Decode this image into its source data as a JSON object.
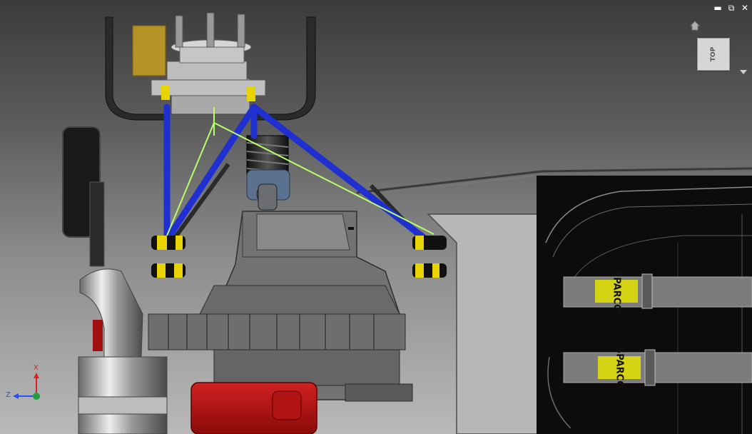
{
  "window_controls": {
    "minimize": "▬",
    "restore": "⧉",
    "close": "✕"
  },
  "viewcube": {
    "face_label": "TOP"
  },
  "triad": {
    "x_label": "X",
    "z_label": "Z",
    "x_color": "#e02020",
    "z_color": "#2a4cff",
    "y_color": "#22a040"
  },
  "decals": {
    "belt_text": "SPARCO"
  },
  "colors": {
    "a_arm": "#1f2fd0",
    "sketch_line": "#b6ff6a",
    "bushing": "#e8d400",
    "tank": "#b01010",
    "caliper": "#c8a020",
    "belt_pad": "#d4d414"
  }
}
